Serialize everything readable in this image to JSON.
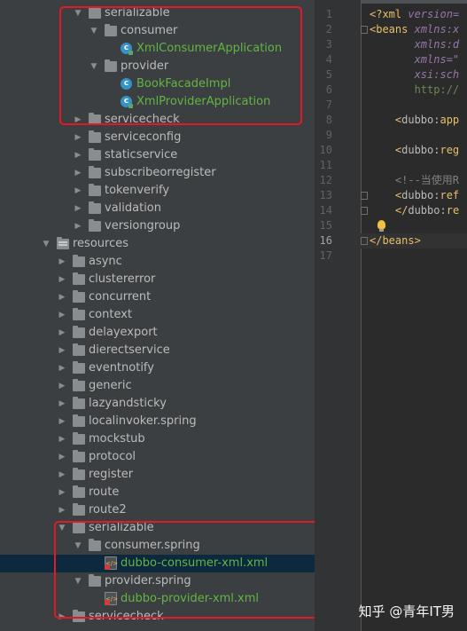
{
  "tree": [
    {
      "label": "serializable",
      "indent": 0,
      "expanded": true,
      "icon": "folder",
      "name": "tree-item-serializable-java"
    },
    {
      "label": "consumer",
      "indent": 1,
      "expanded": true,
      "icon": "folder",
      "name": "tree-item-consumer"
    },
    {
      "label": "XmlConsumerApplication",
      "indent": 2,
      "icon": "class-run",
      "green": true,
      "name": "tree-item-xml-consumer-application"
    },
    {
      "label": "provider",
      "indent": 1,
      "expanded": true,
      "icon": "folder",
      "name": "tree-item-provider"
    },
    {
      "label": "BookFacadeImpl",
      "indent": 2,
      "icon": "class",
      "green": true,
      "name": "tree-item-book-facade-impl"
    },
    {
      "label": "XmlProviderApplication",
      "indent": 2,
      "icon": "class-run",
      "green": true,
      "name": "tree-item-xml-provider-application"
    },
    {
      "label": "servicecheck",
      "indent": 0,
      "expanded": false,
      "icon": "folder",
      "name": "tree-item-servicecheck"
    },
    {
      "label": "serviceconfig",
      "indent": 0,
      "expanded": false,
      "icon": "folder",
      "name": "tree-item-serviceconfig"
    },
    {
      "label": "staticservice",
      "indent": 0,
      "expanded": false,
      "icon": "folder",
      "name": "tree-item-staticservice"
    },
    {
      "label": "subscribeorregister",
      "indent": 0,
      "expanded": false,
      "icon": "folder",
      "name": "tree-item-subscribeorregister"
    },
    {
      "label": "tokenverify",
      "indent": 0,
      "expanded": false,
      "icon": "folder",
      "name": "tree-item-tokenverify"
    },
    {
      "label": "validation",
      "indent": 0,
      "expanded": false,
      "icon": "folder",
      "name": "tree-item-validation"
    },
    {
      "label": "versiongroup",
      "indent": 0,
      "expanded": false,
      "icon": "folder",
      "name": "tree-item-versiongroup"
    },
    {
      "label": "resources",
      "indent": -2,
      "expanded": true,
      "icon": "resfolder",
      "name": "tree-item-resources"
    },
    {
      "label": "async",
      "indent": -1,
      "expanded": false,
      "icon": "folder",
      "name": "tree-item-async"
    },
    {
      "label": "clustererror",
      "indent": -1,
      "expanded": false,
      "icon": "folder",
      "name": "tree-item-clustererror"
    },
    {
      "label": "concurrent",
      "indent": -1,
      "expanded": false,
      "icon": "folder",
      "name": "tree-item-concurrent"
    },
    {
      "label": "context",
      "indent": -1,
      "expanded": false,
      "icon": "folder",
      "name": "tree-item-context"
    },
    {
      "label": "delayexport",
      "indent": -1,
      "expanded": false,
      "icon": "folder",
      "name": "tree-item-delayexport"
    },
    {
      "label": "dierectservice",
      "indent": -1,
      "expanded": false,
      "icon": "folder",
      "name": "tree-item-dierectservice"
    },
    {
      "label": "eventnotify",
      "indent": -1,
      "expanded": false,
      "icon": "folder",
      "name": "tree-item-eventnotify"
    },
    {
      "label": "generic",
      "indent": -1,
      "expanded": false,
      "icon": "folder",
      "name": "tree-item-generic"
    },
    {
      "label": "lazyandsticky",
      "indent": -1,
      "expanded": false,
      "icon": "folder",
      "name": "tree-item-lazyandsticky"
    },
    {
      "label": "localinvoker.spring",
      "indent": -1,
      "expanded": false,
      "icon": "folder",
      "name": "tree-item-localinvoker-spring"
    },
    {
      "label": "mockstub",
      "indent": -1,
      "expanded": false,
      "icon": "folder",
      "name": "tree-item-mockstub"
    },
    {
      "label": "protocol",
      "indent": -1,
      "expanded": false,
      "icon": "folder",
      "name": "tree-item-protocol"
    },
    {
      "label": "register",
      "indent": -1,
      "expanded": false,
      "icon": "folder",
      "name": "tree-item-register"
    },
    {
      "label": "route",
      "indent": -1,
      "expanded": false,
      "icon": "folder",
      "name": "tree-item-route"
    },
    {
      "label": "route2",
      "indent": -1,
      "expanded": false,
      "icon": "folder",
      "name": "tree-item-route2"
    },
    {
      "label": "serializable",
      "indent": -1,
      "expanded": true,
      "icon": "folder",
      "name": "tree-item-serializable-resources"
    },
    {
      "label": "consumer.spring",
      "indent": 0,
      "expanded": true,
      "icon": "folder",
      "name": "tree-item-consumer-spring"
    },
    {
      "label": "dubbo-consumer-xml.xml",
      "indent": 1,
      "icon": "xml",
      "green": true,
      "selected": true,
      "name": "tree-item-dubbo-consumer-xml"
    },
    {
      "label": "provider.spring",
      "indent": 0,
      "expanded": true,
      "icon": "folder",
      "name": "tree-item-provider-spring"
    },
    {
      "label": "dubbo-provider-xml.xml",
      "indent": 1,
      "icon": "xml",
      "green": true,
      "name": "tree-item-dubbo-provider-xml"
    },
    {
      "label": "servicecheck",
      "indent": -1,
      "expanded": false,
      "icon": "folder",
      "name": "tree-item-servicecheck-resources"
    }
  ],
  "editor": {
    "lines": [
      {
        "n": "1",
        "parts": [
          {
            "t": "<?",
            "c": "k-tag"
          },
          {
            "t": "xml ",
            "c": "k-tag"
          },
          {
            "t": "version=",
            "c": "k-ital"
          }
        ]
      },
      {
        "n": "2",
        "parts": [
          {
            "t": "<",
            "c": "k-tag"
          },
          {
            "t": "beans ",
            "c": "k-tag"
          },
          {
            "t": "xmlns:x",
            "c": "k-ital"
          }
        ]
      },
      {
        "n": "3",
        "parts": [
          {
            "t": "       xmlns:d",
            "c": "k-ital"
          }
        ]
      },
      {
        "n": "4",
        "parts": [
          {
            "t": "       xmlns=\"",
            "c": "k-ital"
          }
        ]
      },
      {
        "n": "5",
        "parts": [
          {
            "t": "       xsi:sch",
            "c": "k-ital"
          }
        ]
      },
      {
        "n": "6",
        "parts": [
          {
            "t": "       http://",
            "c": "k-str"
          }
        ]
      },
      {
        "n": "7",
        "parts": []
      },
      {
        "n": "8",
        "parts": [
          {
            "t": "    <",
            "c": "k-tag"
          },
          {
            "t": "dubbo:",
            "c": "k-attr"
          },
          {
            "t": "app",
            "c": "k-tag"
          }
        ]
      },
      {
        "n": "9",
        "parts": []
      },
      {
        "n": "10",
        "parts": [
          {
            "t": "    <",
            "c": "k-tag"
          },
          {
            "t": "dubbo:",
            "c": "k-attr"
          },
          {
            "t": "reg",
            "c": "k-tag"
          }
        ]
      },
      {
        "n": "11",
        "parts": []
      },
      {
        "n": "12",
        "parts": [
          {
            "t": "    <!--当使用R",
            "c": "k-cmt"
          }
        ]
      },
      {
        "n": "13",
        "parts": [
          {
            "t": "    <",
            "c": "k-tag"
          },
          {
            "t": "dubbo:",
            "c": "k-attr"
          },
          {
            "t": "ref",
            "c": "k-tag"
          }
        ]
      },
      {
        "n": "14",
        "parts": [
          {
            "t": "    </",
            "c": "k-tag"
          },
          {
            "t": "dubbo:",
            "c": "k-attr"
          },
          {
            "t": "re",
            "c": "k-tag"
          }
        ]
      },
      {
        "n": "15",
        "parts": []
      },
      {
        "n": "16",
        "parts": [
          {
            "t": "</",
            "c": "k-tag"
          },
          {
            "t": "beans",
            "c": "k-tag"
          },
          {
            "t": ">",
            "c": "k-tag"
          }
        ]
      },
      {
        "n": "17",
        "parts": []
      }
    ]
  },
  "watermark": "知乎 @青年IT男"
}
